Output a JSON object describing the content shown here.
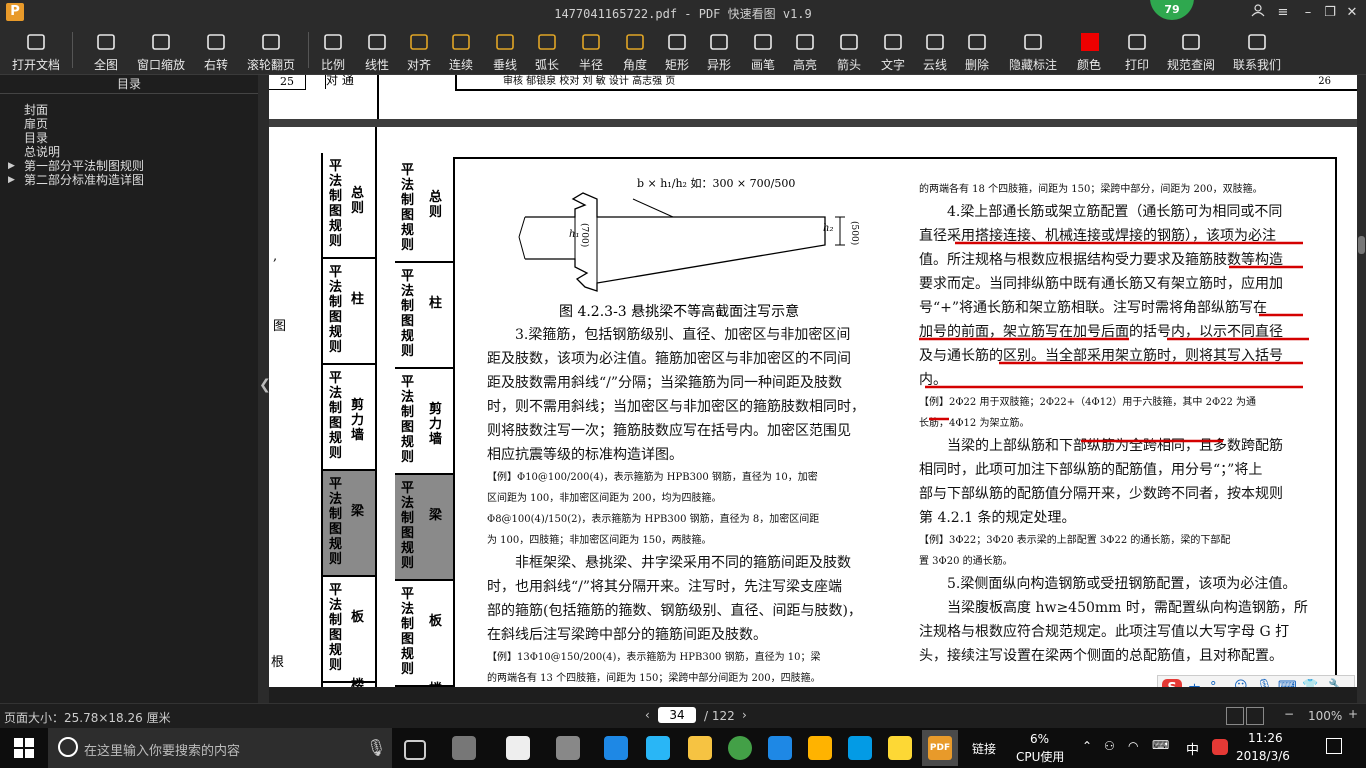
{
  "window": {
    "title": "1477041165722.pdf - PDF 快速看图 v1.9",
    "app_icon": "P",
    "badge": "79"
  },
  "toolbar": [
    {
      "label": "打开文档",
      "icon": "folder-icon"
    },
    {
      "label": "全图",
      "icon": "fit-icon"
    },
    {
      "label": "窗口缩放",
      "icon": "zoom-icon"
    },
    {
      "label": "右转",
      "icon": "rotate-icon"
    },
    {
      "label": "滚轮翻页",
      "icon": "mouse-icon"
    },
    {
      "label": "比例",
      "icon": "scale-icon"
    },
    {
      "label": "线性",
      "icon": "linear-icon"
    },
    {
      "label": "对齐",
      "icon": "align-icon"
    },
    {
      "label": "连续",
      "icon": "continuous-icon"
    },
    {
      "label": "垂线",
      "icon": "perpendicular-icon"
    },
    {
      "label": "弧长",
      "icon": "arc-icon"
    },
    {
      "label": "半径",
      "icon": "radius-icon"
    },
    {
      "label": "角度",
      "icon": "angle-icon"
    },
    {
      "label": "矩形",
      "icon": "rect-icon"
    },
    {
      "label": "异形",
      "icon": "polygon-icon"
    },
    {
      "label": "画笔",
      "icon": "pen-icon"
    },
    {
      "label": "高亮",
      "icon": "highlight-icon"
    },
    {
      "label": "箭头",
      "icon": "arrow-icon"
    },
    {
      "label": "文字",
      "icon": "text-icon"
    },
    {
      "label": "云线",
      "icon": "cloud-icon"
    },
    {
      "label": "删除",
      "icon": "eraser-icon"
    },
    {
      "label": "隐藏标注",
      "icon": "eye-icon"
    },
    {
      "label": "颜色",
      "icon": "color-icon"
    },
    {
      "label": "打印",
      "icon": "print-icon"
    },
    {
      "label": "规范查阅",
      "icon": "book-icon"
    },
    {
      "label": "联系我们",
      "icon": "contact-icon"
    }
  ],
  "sidebar": {
    "title": "目录",
    "items": [
      "封面",
      "扉页",
      "目录",
      "总说明",
      "第一部分平法制图规则",
      "第二部分标准构造详图"
    ]
  },
  "page_top": {
    "n1": "25",
    "w1": "对 通",
    "right_num": "26",
    "row": "审核 郁银泉 校对 刘 敏 设计 高志强 页"
  },
  "tabs_left": [
    {
      "main": "平法制图规则",
      "sub": "总则"
    },
    {
      "main": "平法制图规则",
      "sub": "柱"
    },
    {
      "main": "平法制图规则",
      "sub": "剪力墙"
    },
    {
      "main": "平法制图规则",
      "sub": "梁"
    },
    {
      "main": "平法制图规则",
      "sub": "板"
    },
    {
      "main": "平",
      "sub": "楼"
    }
  ],
  "tabs_inner": [
    {
      "main": "平法制图规则",
      "sub": "总则"
    },
    {
      "main": "平法制图规则",
      "sub": "柱"
    },
    {
      "main": "平法制图规则",
      "sub": "剪力墙"
    },
    {
      "main": "平法制图规则",
      "sub": "梁"
    },
    {
      "main": "平法制图规则",
      "sub": "板"
    },
    {
      "main": "平",
      "sub": "楼"
    }
  ],
  "edge_chars": [
    ",",
    "图",
    "根"
  ],
  "figure": {
    "annot": "b × h₁/h₂ 如：300 × 700/500",
    "h1": "h₁",
    "v1": "(700)",
    "h2": "h₂",
    "v2": "(500)",
    "caption": "图 4.2.3-3  悬挑梁不等高截面注写示意"
  },
  "left_col": [
    {
      "t": "3.梁箍筋，包括钢筋级别、直径、加密区与非加密区间",
      "s": "p"
    },
    {
      "t": "距及肢数，该项为必注值。箍筋加密区与非加密区的不同间",
      "s": "p"
    },
    {
      "t": "距及肢数需用斜线“/”分隔；当梁箍筋为同一种间距及肢数",
      "s": "p"
    },
    {
      "t": "时，则不需用斜线；当加密区与非加密区的箍筋肢数相同时，",
      "s": "p"
    },
    {
      "t": "则将肢数注写一次；箍筋肢数应写在括号内。加密区范围见",
      "s": "p"
    },
    {
      "t": "相应抗震等级的标准构造详图。",
      "s": "p"
    },
    {
      "t": "【例】Φ10@100/200(4)，表示箍筋为 HPB300 钢筋，直径为 10，加密",
      "s": "s"
    },
    {
      "t": "区间距为 100，非加密区间距为 200，均为四肢箍。",
      "s": "s"
    },
    {
      "t": "Φ8@100(4)/150(2)，表示箍筋为 HPB300 钢筋，直径为 8，加密区间距",
      "s": "s"
    },
    {
      "t": "为 100，四肢箍；非加密区间距为 150，两肢箍。",
      "s": "s"
    },
    {
      "t": "非框架梁、悬挑梁、井字梁采用不同的箍筋间距及肢数",
      "s": "p"
    },
    {
      "t": "时，也用斜线“/”将其分隔开来。注写时，先注写梁支座端",
      "s": "p"
    },
    {
      "t": "部的箍筋(包括箍筋的箍数、钢筋级别、直径、间距与肢数)，",
      "s": "p"
    },
    {
      "t": "在斜线后注写梁跨中部分的箍筋间距及肢数。",
      "s": "p"
    },
    {
      "t": "【例】13Φ10@150/200(4)，表示箍筋为 HPB300 钢筋，直径为 10；梁",
      "s": "s"
    },
    {
      "t": "的两端各有 13 个四肢箍，间距为 150；梁跨中部分间距为 200，四肢箍。",
      "s": "s"
    }
  ],
  "right_col": [
    {
      "t": "的两端各有 18 个四肢箍，间距为 150；梁跨中部分，间距为 200，双肢箍。",
      "s": "s"
    },
    {
      "t": "4.梁上部通长筋或架立筋配置（通长筋可为相同或不同",
      "s": "p"
    },
    {
      "t": "直径采用搭接连接、机械连接或焊接的钢筋），该项为必注",
      "s": "p"
    },
    {
      "t": "值。所注规格与根数应根据结构受力要求及箍筋肢数等构造",
      "s": "p"
    },
    {
      "t": "要求而定。当同排纵筋中既有通长筋又有架立筋时，应用加",
      "s": "p"
    },
    {
      "t": "号“+”将通长筋和架立筋相联。注写时需将角部纵筋写在",
      "s": "p"
    },
    {
      "t": "加号的前面，架立筋写在加号后面的括号内，以示不同直径",
      "s": "p"
    },
    {
      "t": "及与通长筋的区别。当全部采用架立筋时，则将其写入括号",
      "s": "p"
    },
    {
      "t": "内。",
      "s": "p"
    },
    {
      "t": "【例】2Φ22 用于双肢箍；2Φ22+（4Φ12）用于六肢箍，其中 2Φ22 为通",
      "s": "s"
    },
    {
      "t": "长筋，4Φ12 为架立筋。",
      "s": "s"
    },
    {
      "t": "当梁的上部纵筋和下部纵筋为全跨相同，且多数跨配筋",
      "s": "p"
    },
    {
      "t": "相同时，此项可加注下部纵筋的配筋值，用分号“；”将上",
      "s": "p"
    },
    {
      "t": "部与下部纵筋的配筋值分隔开来，少数跨不同者，按本规则",
      "s": "p"
    },
    {
      "t": "第 4.2.1 条的规定处理。",
      "s": "p"
    },
    {
      "t": "【例】3Φ22；3Φ20 表示梁的上部配置 3Φ22 的通长筋，梁的下部配",
      "s": "s"
    },
    {
      "t": "置 3Φ20 的通长筋。",
      "s": "s"
    },
    {
      "t": "5.梁侧面纵向构造钢筋或受扭钢筋配置，该项为必注值。",
      "s": "p"
    },
    {
      "t": "当梁腹板高度 hw≥450mm 时，需配置纵向构造钢筋，所",
      "s": "p"
    },
    {
      "t": "注规格与根数应符合规范规定。此项注写值以大写字母 G 打",
      "s": "p"
    },
    {
      "t": "头，接续注写设置在梁两个侧面的总配筋值，且对称配置。",
      "s": "p"
    }
  ],
  "status": {
    "page_size": "页面大小：25.78×18.26 厘米",
    "page_current": "34",
    "page_total": "/ 122",
    "zoom": "100%",
    "ime": "中"
  },
  "taskbar": {
    "search_placeholder": "在这里输入你要搜索的内容",
    "link": "链接",
    "cpu_pct": "6%",
    "cpu_label": "CPU使用",
    "lang": "中",
    "time": "11:26",
    "date": "2018/3/6"
  },
  "colors": {
    "annotation_red": "#d40000",
    "toolbar_bg": "#2b2b2b",
    "icon_gold": "#e0a526"
  }
}
